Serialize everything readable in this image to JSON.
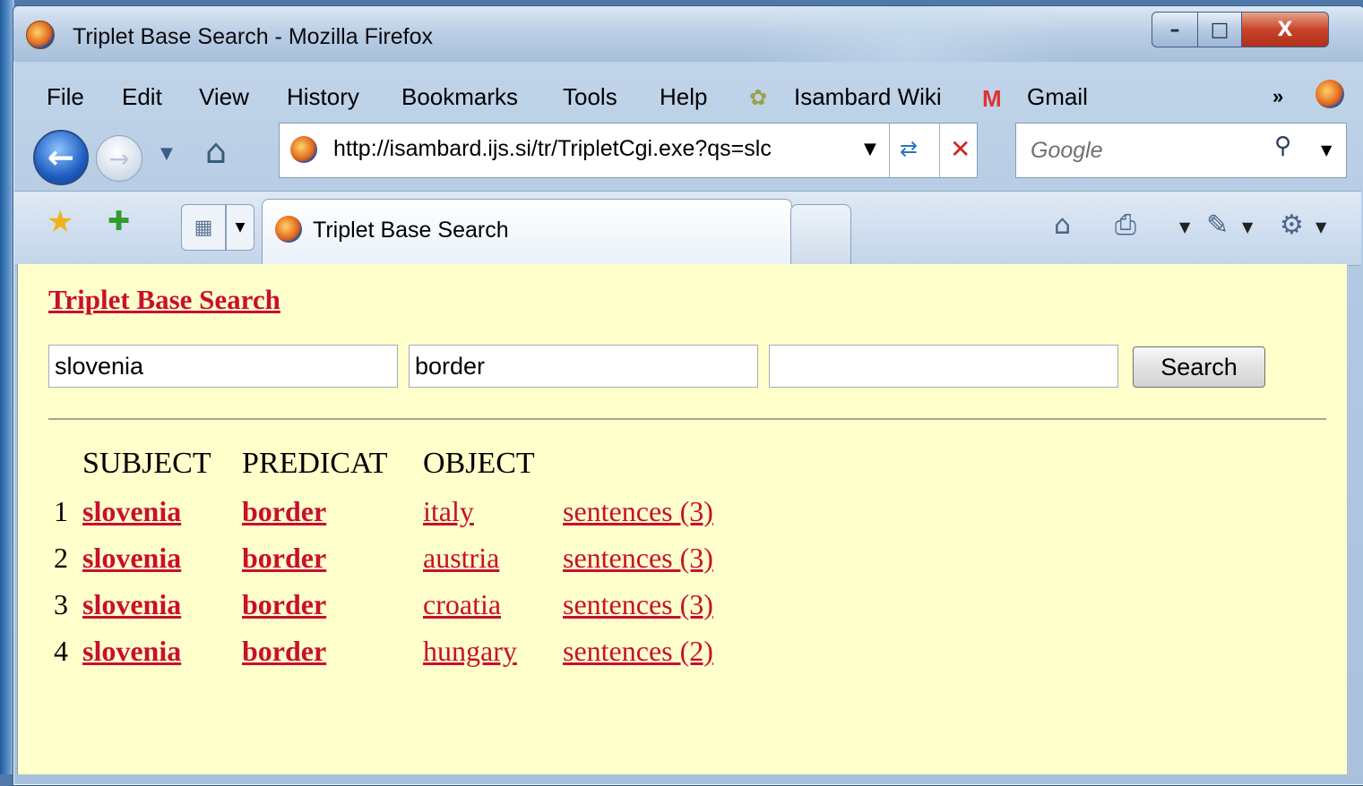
{
  "window": {
    "title": "Triplet Base Search - Mozilla Firefox"
  },
  "menu": {
    "items": [
      {
        "label": "File"
      },
      {
        "label": "Edit"
      },
      {
        "label": "View"
      },
      {
        "label": "History"
      },
      {
        "label": "Bookmarks"
      },
      {
        "label": "Tools"
      },
      {
        "label": "Help"
      }
    ],
    "bookmarks": [
      {
        "label": "Isambard Wiki",
        "icon": "isambard-icon"
      },
      {
        "label": "Gmail",
        "icon": "gmail-icon"
      }
    ],
    "more_label": "»"
  },
  "nav": {
    "url": "http://isambard.ijs.si/tr/TripletCgi.exe?qs=slc",
    "search_placeholder": "Google"
  },
  "tabs": {
    "active_label": "Triplet Base Search"
  },
  "page": {
    "title": "Triplet Base Search",
    "subject_value": "slovenia",
    "predicate_value": "border",
    "object_value": "",
    "search_button": "Search",
    "headers": {
      "subject": "SUBJECT",
      "predicate": "PREDICAT",
      "object": "OBJECT"
    },
    "results": [
      {
        "num": "1",
        "subject": "slovenia",
        "predicate": "border",
        "object": "italy",
        "sentences": "sentences (3)"
      },
      {
        "num": "2",
        "subject": "slovenia",
        "predicate": "border",
        "object": "austria",
        "sentences": "sentences (3)"
      },
      {
        "num": "3",
        "subject": "slovenia",
        "predicate": "border",
        "object": "croatia",
        "sentences": "sentences (3)"
      },
      {
        "num": "4",
        "subject": "slovenia",
        "predicate": "border",
        "object": "hungary",
        "sentences": "sentences (2)"
      }
    ]
  },
  "colors": {
    "link": "#c8102e",
    "page_background": "#ffffcc"
  }
}
